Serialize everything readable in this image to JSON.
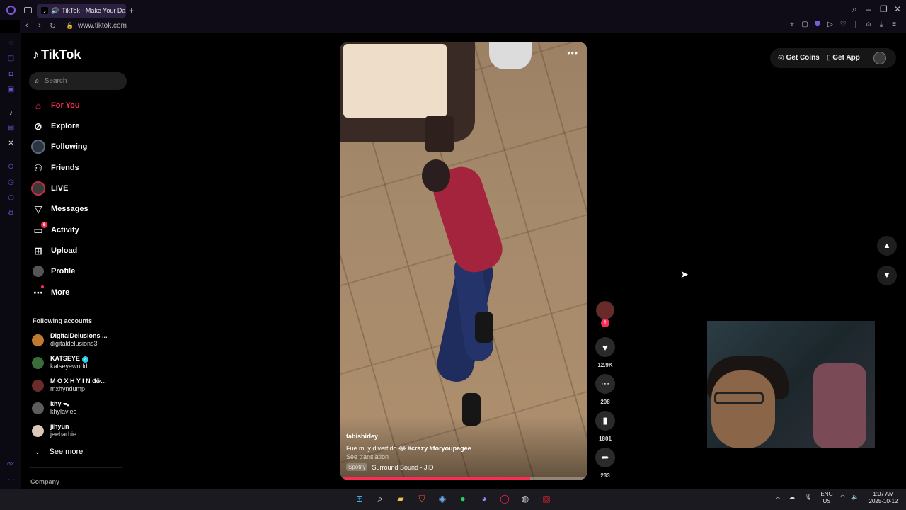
{
  "browser": {
    "tab_title": "TikTok - Make Your Da",
    "new_tab_label": "+",
    "url": "www.tiktok.com",
    "gx_label": "GX"
  },
  "tiktok": {
    "logo_text": "TikTok",
    "search_placeholder": "Search",
    "nav": [
      {
        "label": "For You",
        "icon": "home-icon"
      },
      {
        "label": "Explore",
        "icon": "compass-icon"
      },
      {
        "label": "Following",
        "icon": "avatar"
      },
      {
        "label": "Friends",
        "icon": "friends-icon"
      },
      {
        "label": "LIVE",
        "icon": "live-avatar"
      },
      {
        "label": "Messages",
        "icon": "send-icon"
      },
      {
        "label": "Activity",
        "icon": "activity-icon",
        "badge": "6"
      },
      {
        "label": "Upload",
        "icon": "upload-icon"
      },
      {
        "label": "Profile",
        "icon": "profile-avatar"
      },
      {
        "label": "More",
        "icon": "more-dots-icon"
      }
    ],
    "following_title": "Following accounts",
    "following": [
      {
        "name": "DigitalDelusions ...",
        "handle": "digitaldelusions3",
        "color": "#c07a30"
      },
      {
        "name": "KATSEYE",
        "handle": "katseyeworld",
        "verified": true,
        "color": "#3b6d3b"
      },
      {
        "name": "M O X H Y I N đữ...",
        "handle": "mxhyndump",
        "color": "#6b2b2b"
      },
      {
        "name": "khy ᯓ",
        "handle": "khylaviee",
        "color": "#5c5c5c"
      },
      {
        "name": "jihyun",
        "handle": "jeebarbie",
        "color": "#d9c7b8"
      }
    ],
    "see_more": "See more",
    "company": "Company",
    "get_coins": "Get Coins",
    "get_app": "Get App"
  },
  "video": {
    "author": "fabishirley",
    "caption": "Fue muy divertido 😂 ",
    "hashtags": "#crazy #foryoupagee",
    "see_translation": "See translation",
    "sound_source": "Spotify",
    "sound": "Surround Sound - JID",
    "progress": 0.77,
    "likes": "12.9K",
    "comments": "208",
    "saves": "1801",
    "shares": "233"
  },
  "taskbar": {
    "lang1": "ENG",
    "lang2": "US",
    "time": "1:07 AM",
    "date": "2025-10-12"
  },
  "colors": {
    "accent": "#fe2c55",
    "gx_purple": "#6a4fc4",
    "tab_bg": "#2b2040"
  }
}
